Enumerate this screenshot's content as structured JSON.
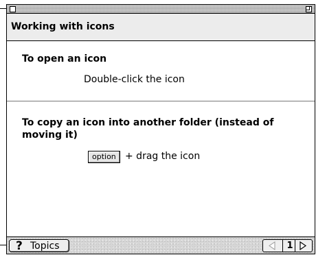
{
  "window": {
    "title": ""
  },
  "header": {
    "title": "Working with icons"
  },
  "section1": {
    "title": "To open an icon",
    "step": "Double-click the icon"
  },
  "section2": {
    "title": "To copy an icon into another folder (instead of moving it)",
    "key_label": "option",
    "step": "+  drag the icon"
  },
  "footer": {
    "topics_icon": "question-mark-icon",
    "topics_label": "Topics",
    "page_number": "1"
  },
  "colors": {
    "header_bg": "#ececec",
    "footer_bg": "#d6d6d6",
    "border": "#000000"
  }
}
